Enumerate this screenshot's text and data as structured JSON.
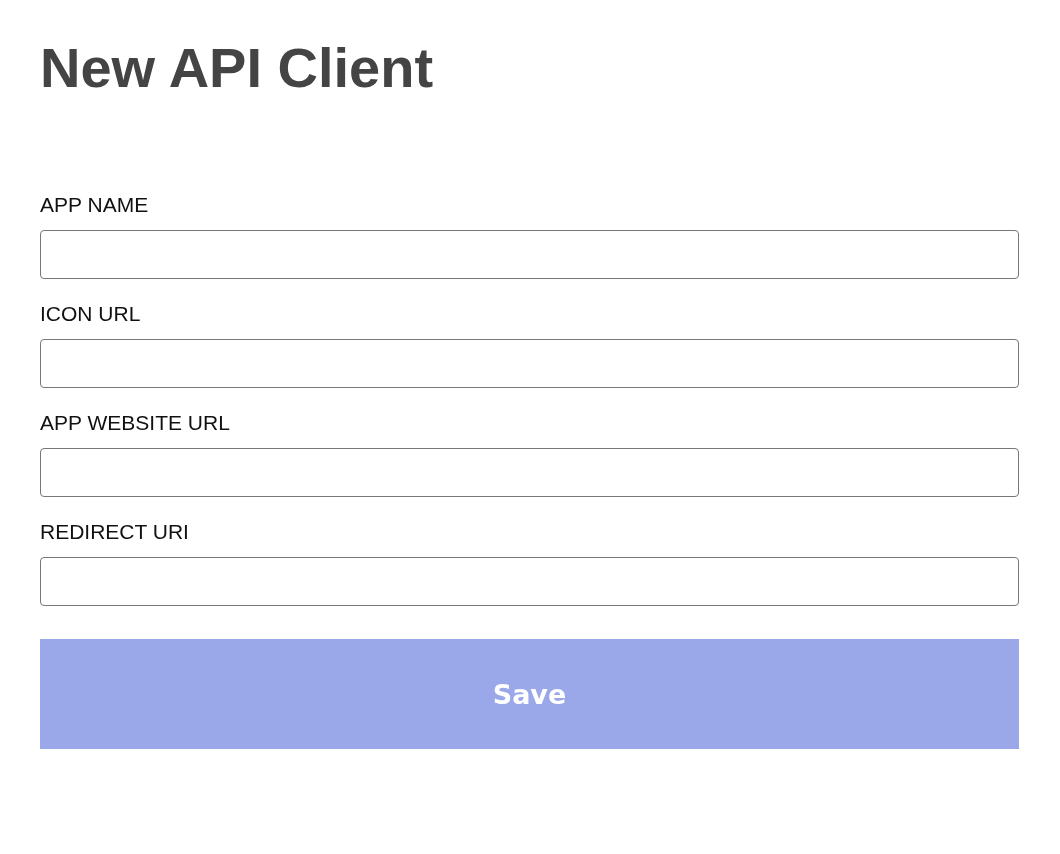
{
  "title": "New API Client",
  "fields": [
    {
      "label": "APP NAME"
    },
    {
      "label": "ICON URL"
    },
    {
      "label": "APP WEBSITE URL"
    },
    {
      "label": "REDIRECT URI"
    }
  ],
  "save_button": {
    "label": "Save",
    "disabled": true
  }
}
